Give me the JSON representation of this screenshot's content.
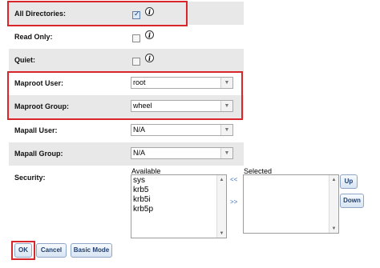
{
  "form": {
    "all_directories": {
      "label": "All Directories:",
      "checked": true,
      "info_icon": "info-icon"
    },
    "read_only": {
      "label": "Read Only:",
      "checked": false,
      "info_icon": "info-icon"
    },
    "quiet": {
      "label": "Quiet:",
      "checked": false,
      "info_icon": "info-icon"
    },
    "maproot_user": {
      "label": "Maproot User:",
      "value": "root"
    },
    "maproot_group": {
      "label": "Maproot Group:",
      "value": "wheel"
    },
    "mapall_user": {
      "label": "Mapall User:",
      "value": "N/A"
    },
    "mapall_group": {
      "label": "Mapall Group:",
      "value": "N/A"
    },
    "security": {
      "label": "Security:",
      "available_caption": "Available",
      "selected_caption": "Selected",
      "available_options": [
        "sys",
        "krb5",
        "krb5i",
        "krb5p"
      ],
      "selected_options": [],
      "move_left_label": "<<",
      "move_right_label": ">>",
      "up_label": "Up",
      "down_label": "Down"
    }
  },
  "buttons": {
    "ok": "OK",
    "cancel": "Cancel",
    "basic_mode": "Basic Mode"
  },
  "colors": {
    "highlight": "#d9262b",
    "row_alt": "#e8e8e8",
    "link": "#3b6fb5"
  }
}
